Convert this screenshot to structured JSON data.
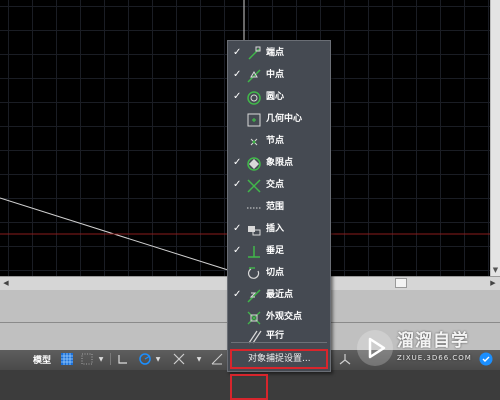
{
  "colors": {
    "canvas": "#000000",
    "grid": "#1a1d24",
    "menu_bg": "#454a52",
    "highlight": "#d8252c",
    "statusbar": "#4a4a4a",
    "accent_blue": "#1b8fff"
  },
  "snap_menu": {
    "items": [
      {
        "label": "端点",
        "checked": true,
        "icon": "endpoint-icon"
      },
      {
        "label": "中点",
        "checked": true,
        "icon": "midpoint-icon"
      },
      {
        "label": "圆心",
        "checked": true,
        "icon": "center-icon"
      },
      {
        "label": "几何中心",
        "checked": false,
        "icon": "geometric-center-icon"
      },
      {
        "label": "节点",
        "checked": false,
        "icon": "node-icon"
      },
      {
        "label": "象限点",
        "checked": true,
        "icon": "quadrant-icon"
      },
      {
        "label": "交点",
        "checked": true,
        "icon": "intersection-icon"
      },
      {
        "label": "范围",
        "checked": false,
        "icon": "extension-icon"
      },
      {
        "label": "插入",
        "checked": true,
        "icon": "insertion-icon"
      },
      {
        "label": "垂足",
        "checked": true,
        "icon": "perpendicular-icon"
      },
      {
        "label": "切点",
        "checked": false,
        "icon": "tangent-icon"
      },
      {
        "label": "最近点",
        "checked": true,
        "icon": "nearest-icon"
      },
      {
        "label": "外观交点",
        "checked": false,
        "icon": "apparent-intersection-icon"
      },
      {
        "label": "平行",
        "checked": false,
        "icon": "parallel-icon"
      }
    ],
    "settings_label": "对象捕捉设置..."
  },
  "statusbar": {
    "model_label": "模型",
    "dropdown_arrow": "▼",
    "icons": [
      "grid-icon",
      "snap-mode-icon",
      "ortho-icon",
      "polar-icon",
      "isodraft-icon",
      "osnap-tracking-icon",
      "object-snap-icon",
      "lineweight-icon",
      "annotation-scale-icon",
      "workspace-icon",
      "fullscreen-icon"
    ]
  },
  "watermark": {
    "name": "溜溜自学",
    "url": "ZIXUE.3D66.COM"
  }
}
